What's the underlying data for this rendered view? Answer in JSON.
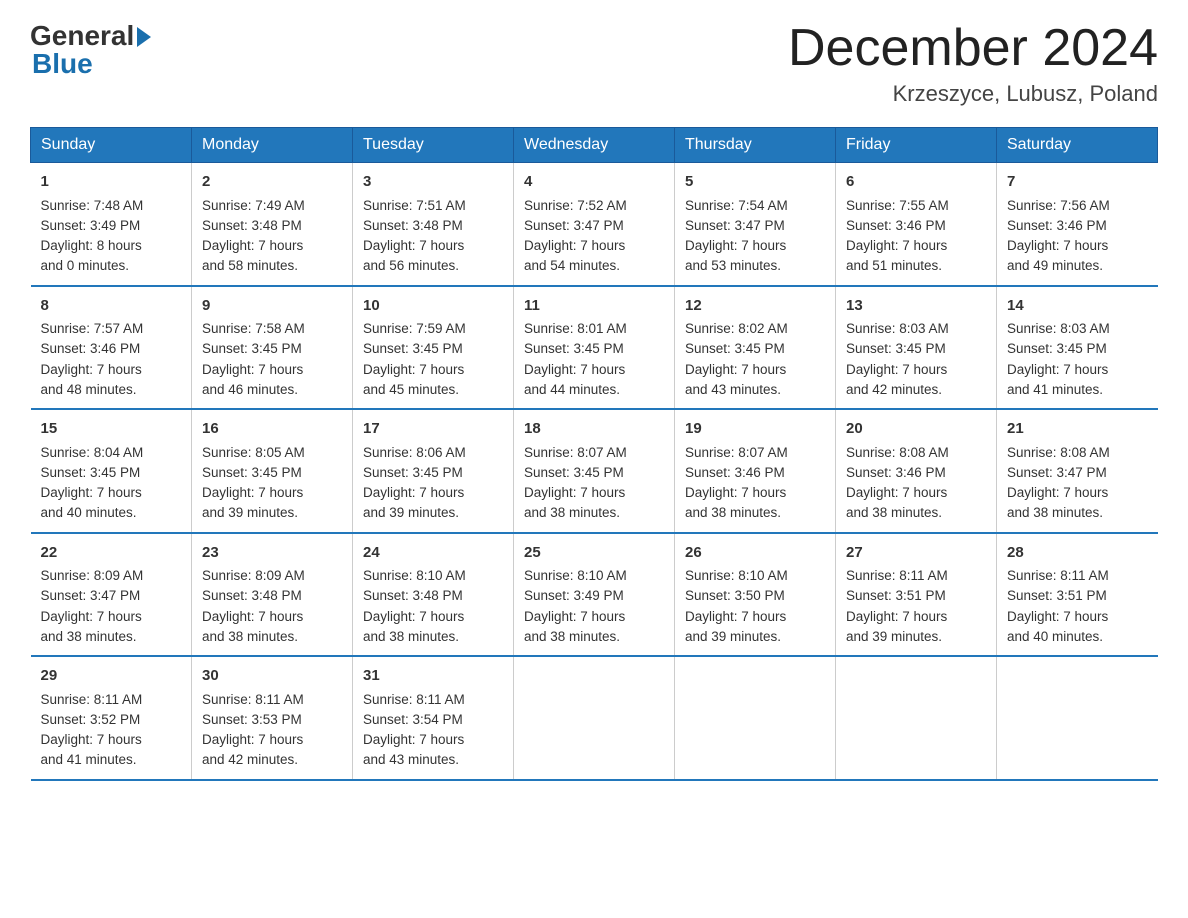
{
  "header": {
    "logo_general": "General",
    "logo_blue": "Blue",
    "month_title": "December 2024",
    "location": "Krzeszyce, Lubusz, Poland"
  },
  "days_of_week": [
    "Sunday",
    "Monday",
    "Tuesday",
    "Wednesday",
    "Thursday",
    "Friday",
    "Saturday"
  ],
  "weeks": [
    [
      {
        "day": "1",
        "info": "Sunrise: 7:48 AM\nSunset: 3:49 PM\nDaylight: 8 hours\nand 0 minutes."
      },
      {
        "day": "2",
        "info": "Sunrise: 7:49 AM\nSunset: 3:48 PM\nDaylight: 7 hours\nand 58 minutes."
      },
      {
        "day": "3",
        "info": "Sunrise: 7:51 AM\nSunset: 3:48 PM\nDaylight: 7 hours\nand 56 minutes."
      },
      {
        "day": "4",
        "info": "Sunrise: 7:52 AM\nSunset: 3:47 PM\nDaylight: 7 hours\nand 54 minutes."
      },
      {
        "day": "5",
        "info": "Sunrise: 7:54 AM\nSunset: 3:47 PM\nDaylight: 7 hours\nand 53 minutes."
      },
      {
        "day": "6",
        "info": "Sunrise: 7:55 AM\nSunset: 3:46 PM\nDaylight: 7 hours\nand 51 minutes."
      },
      {
        "day": "7",
        "info": "Sunrise: 7:56 AM\nSunset: 3:46 PM\nDaylight: 7 hours\nand 49 minutes."
      }
    ],
    [
      {
        "day": "8",
        "info": "Sunrise: 7:57 AM\nSunset: 3:46 PM\nDaylight: 7 hours\nand 48 minutes."
      },
      {
        "day": "9",
        "info": "Sunrise: 7:58 AM\nSunset: 3:45 PM\nDaylight: 7 hours\nand 46 minutes."
      },
      {
        "day": "10",
        "info": "Sunrise: 7:59 AM\nSunset: 3:45 PM\nDaylight: 7 hours\nand 45 minutes."
      },
      {
        "day": "11",
        "info": "Sunrise: 8:01 AM\nSunset: 3:45 PM\nDaylight: 7 hours\nand 44 minutes."
      },
      {
        "day": "12",
        "info": "Sunrise: 8:02 AM\nSunset: 3:45 PM\nDaylight: 7 hours\nand 43 minutes."
      },
      {
        "day": "13",
        "info": "Sunrise: 8:03 AM\nSunset: 3:45 PM\nDaylight: 7 hours\nand 42 minutes."
      },
      {
        "day": "14",
        "info": "Sunrise: 8:03 AM\nSunset: 3:45 PM\nDaylight: 7 hours\nand 41 minutes."
      }
    ],
    [
      {
        "day": "15",
        "info": "Sunrise: 8:04 AM\nSunset: 3:45 PM\nDaylight: 7 hours\nand 40 minutes."
      },
      {
        "day": "16",
        "info": "Sunrise: 8:05 AM\nSunset: 3:45 PM\nDaylight: 7 hours\nand 39 minutes."
      },
      {
        "day": "17",
        "info": "Sunrise: 8:06 AM\nSunset: 3:45 PM\nDaylight: 7 hours\nand 39 minutes."
      },
      {
        "day": "18",
        "info": "Sunrise: 8:07 AM\nSunset: 3:45 PM\nDaylight: 7 hours\nand 38 minutes."
      },
      {
        "day": "19",
        "info": "Sunrise: 8:07 AM\nSunset: 3:46 PM\nDaylight: 7 hours\nand 38 minutes."
      },
      {
        "day": "20",
        "info": "Sunrise: 8:08 AM\nSunset: 3:46 PM\nDaylight: 7 hours\nand 38 minutes."
      },
      {
        "day": "21",
        "info": "Sunrise: 8:08 AM\nSunset: 3:47 PM\nDaylight: 7 hours\nand 38 minutes."
      }
    ],
    [
      {
        "day": "22",
        "info": "Sunrise: 8:09 AM\nSunset: 3:47 PM\nDaylight: 7 hours\nand 38 minutes."
      },
      {
        "day": "23",
        "info": "Sunrise: 8:09 AM\nSunset: 3:48 PM\nDaylight: 7 hours\nand 38 minutes."
      },
      {
        "day": "24",
        "info": "Sunrise: 8:10 AM\nSunset: 3:48 PM\nDaylight: 7 hours\nand 38 minutes."
      },
      {
        "day": "25",
        "info": "Sunrise: 8:10 AM\nSunset: 3:49 PM\nDaylight: 7 hours\nand 38 minutes."
      },
      {
        "day": "26",
        "info": "Sunrise: 8:10 AM\nSunset: 3:50 PM\nDaylight: 7 hours\nand 39 minutes."
      },
      {
        "day": "27",
        "info": "Sunrise: 8:11 AM\nSunset: 3:51 PM\nDaylight: 7 hours\nand 39 minutes."
      },
      {
        "day": "28",
        "info": "Sunrise: 8:11 AM\nSunset: 3:51 PM\nDaylight: 7 hours\nand 40 minutes."
      }
    ],
    [
      {
        "day": "29",
        "info": "Sunrise: 8:11 AM\nSunset: 3:52 PM\nDaylight: 7 hours\nand 41 minutes."
      },
      {
        "day": "30",
        "info": "Sunrise: 8:11 AM\nSunset: 3:53 PM\nDaylight: 7 hours\nand 42 minutes."
      },
      {
        "day": "31",
        "info": "Sunrise: 8:11 AM\nSunset: 3:54 PM\nDaylight: 7 hours\nand 43 minutes."
      },
      {
        "day": "",
        "info": ""
      },
      {
        "day": "",
        "info": ""
      },
      {
        "day": "",
        "info": ""
      },
      {
        "day": "",
        "info": ""
      }
    ]
  ]
}
